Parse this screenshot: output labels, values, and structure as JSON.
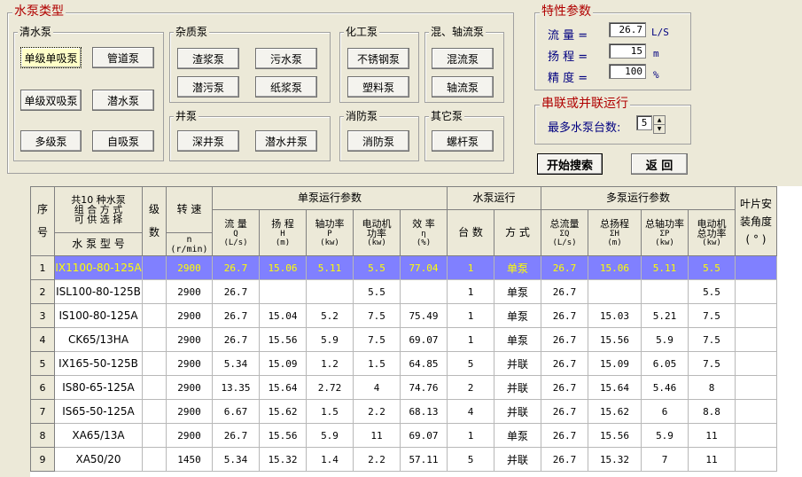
{
  "pump_types": {
    "title": "水泵类型",
    "groups": [
      {
        "key": "clear",
        "title": "清水泵",
        "buttons": [
          "单级单吸泵",
          "管道泵",
          "单级双吸泵",
          "潜水泵",
          "多级泵",
          "自吸泵"
        ]
      },
      {
        "key": "impurity",
        "title": "杂质泵",
        "buttons": [
          "渣浆泵",
          "污水泵",
          "潜污泵",
          "纸浆泵"
        ]
      },
      {
        "key": "well",
        "title": "井泵",
        "buttons": [
          "深井泵",
          "潜水井泵"
        ]
      },
      {
        "key": "chem",
        "title": "化工泵",
        "buttons": [
          "不锈钢泵",
          "塑料泵"
        ]
      },
      {
        "key": "fire",
        "title": "消防泵",
        "buttons": [
          "消防泵"
        ]
      },
      {
        "key": "mixed",
        "title": "混、轴流泵",
        "buttons": [
          "混流泵",
          "轴流泵"
        ]
      },
      {
        "key": "other",
        "title": "其它泵",
        "buttons": [
          "螺杆泵"
        ]
      }
    ],
    "selected": "单级单吸泵"
  },
  "params": {
    "title": "特性参数",
    "rows": [
      {
        "label": "流  量 =",
        "value": "26.7",
        "unit": "L/S"
      },
      {
        "label": "扬  程 =",
        "value": "15",
        "unit": "m"
      },
      {
        "label": "精  度 =",
        "value": "100",
        "unit": "%"
      }
    ]
  },
  "series_parallel": {
    "title": "串联或并联运行",
    "max_label": "最多水泵台数:",
    "max_value": "5"
  },
  "actions": {
    "search": "开始搜索",
    "back": "返  回"
  },
  "colors": {
    "highlight_bg": "#8080ff",
    "highlight_fg": "#ffff00",
    "title_red": "#b00000",
    "label_blue": "#000080"
  },
  "table": {
    "headers": {
      "seq": "序\n\n号",
      "model_top": "共10 种水泵\n组 合 方 式\n可 供 选 择",
      "model": "水 泵 型 号",
      "stage": "级\n\n数",
      "speed": "转  速",
      "speed_sub": "n\n(r/min)",
      "single": "单泵运行参数",
      "pump_run": "水泵运行",
      "multi": "多泵运行参数",
      "blade": "叶片安\n装角度\n( ° )",
      "s_flow": "流  量",
      "s_flow_sub": "Q\n(L/s)",
      "s_head": "扬  程",
      "s_head_sub": "H\n(m)",
      "s_shaft": "轴功率",
      "s_shaft_sub": "P\n(kw)",
      "s_motor": "电动机\n功率",
      "s_motor_sub": "(kw)",
      "s_eff": "效  率",
      "s_eff_sub": "η\n(%)",
      "count": "台  数",
      "mode": "方  式",
      "m_flow": "总流量",
      "m_flow_sub": "ΣQ\n(L/s)",
      "m_head": "总扬程",
      "m_head_sub": "ΣH\n(m)",
      "m_shaft": "总轴功率",
      "m_shaft_sub": "ΣP\n(kw)",
      "m_motor": "电动机\n总功率",
      "m_motor_sub": "(kw)"
    },
    "rows": [
      {
        "no": "1",
        "model": "IX1100-80-125A",
        "stage": "",
        "speed": "2900",
        "q": "26.7",
        "h": "15.06",
        "p": "5.11",
        "pm": "5.5",
        "eff": "77.04",
        "count": "1",
        "mode": "单泵",
        "tq": "26.7",
        "th": "15.06",
        "tp": "5.11",
        "tpm": "5.5",
        "blade": "",
        "highlight": true
      },
      {
        "no": "2",
        "model": "ISL100-80-125B",
        "stage": "",
        "speed": "2900",
        "q": "26.7",
        "h": "",
        "p": "",
        "pm": "5.5",
        "eff": "",
        "count": "1",
        "mode": "单泵",
        "tq": "26.7",
        "th": "",
        "tp": "",
        "tpm": "5.5",
        "blade": ""
      },
      {
        "no": "3",
        "model": "IS100-80-125A",
        "stage": "",
        "speed": "2900",
        "q": "26.7",
        "h": "15.04",
        "p": "5.2",
        "pm": "7.5",
        "eff": "75.49",
        "count": "1",
        "mode": "单泵",
        "tq": "26.7",
        "th": "15.03",
        "tp": "5.21",
        "tpm": "7.5",
        "blade": ""
      },
      {
        "no": "4",
        "model": "CK65/13HA",
        "stage": "",
        "speed": "2900",
        "q": "26.7",
        "h": "15.56",
        "p": "5.9",
        "pm": "7.5",
        "eff": "69.07",
        "count": "1",
        "mode": "单泵",
        "tq": "26.7",
        "th": "15.56",
        "tp": "5.9",
        "tpm": "7.5",
        "blade": ""
      },
      {
        "no": "5",
        "model": "IX165-50-125B",
        "stage": "",
        "speed": "2900",
        "q": "5.34",
        "h": "15.09",
        "p": "1.2",
        "pm": "1.5",
        "eff": "64.85",
        "count": "5",
        "mode": "并联",
        "tq": "26.7",
        "th": "15.09",
        "tp": "6.05",
        "tpm": "7.5",
        "blade": ""
      },
      {
        "no": "6",
        "model": "IS80-65-125A",
        "stage": "",
        "speed": "2900",
        "q": "13.35",
        "h": "15.64",
        "p": "2.72",
        "pm": "4",
        "eff": "74.76",
        "count": "2",
        "mode": "并联",
        "tq": "26.7",
        "th": "15.64",
        "tp": "5.46",
        "tpm": "8",
        "blade": ""
      },
      {
        "no": "7",
        "model": "IS65-50-125A",
        "stage": "",
        "speed": "2900",
        "q": "6.67",
        "h": "15.62",
        "p": "1.5",
        "pm": "2.2",
        "eff": "68.13",
        "count": "4",
        "mode": "并联",
        "tq": "26.7",
        "th": "15.62",
        "tp": "6",
        "tpm": "8.8",
        "blade": ""
      },
      {
        "no": "8",
        "model": "XA65/13A",
        "stage": "",
        "speed": "2900",
        "q": "26.7",
        "h": "15.56",
        "p": "5.9",
        "pm": "11",
        "eff": "69.07",
        "count": "1",
        "mode": "单泵",
        "tq": "26.7",
        "th": "15.56",
        "tp": "5.9",
        "tpm": "11",
        "blade": ""
      },
      {
        "no": "9",
        "model": "XA50/20",
        "stage": "",
        "speed": "1450",
        "q": "5.34",
        "h": "15.32",
        "p": "1.4",
        "pm": "2.2",
        "eff": "57.11",
        "count": "5",
        "mode": "并联",
        "tq": "26.7",
        "th": "15.32",
        "tp": "7",
        "tpm": "11",
        "blade": ""
      }
    ]
  }
}
